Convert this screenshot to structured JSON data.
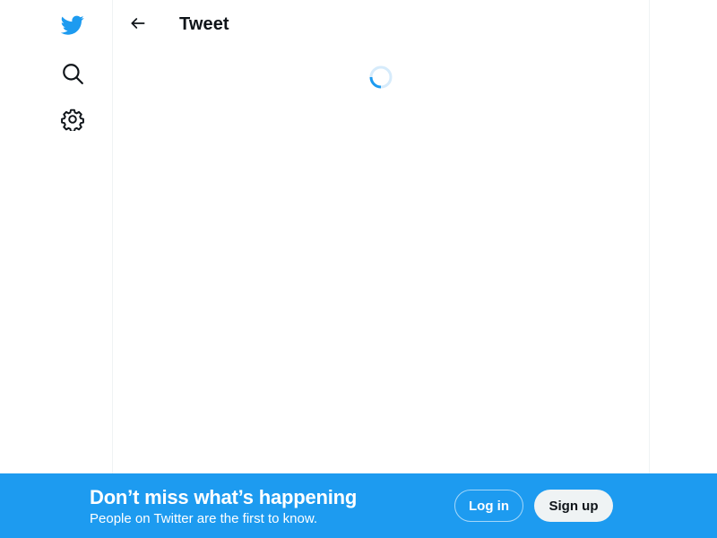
{
  "sidebar": {
    "logo_icon": "twitter-bird-icon",
    "search_icon": "search-icon",
    "settings_icon": "gear-icon"
  },
  "header": {
    "back_icon": "arrow-left-icon",
    "title": "Tweet"
  },
  "content": {
    "loading_indicator": "spinner-icon"
  },
  "banner": {
    "heading": "Don’t miss what’s happening",
    "subtext": "People on Twitter are the first to know.",
    "login_label": "Log in",
    "signup_label": "Sign up"
  },
  "colors": {
    "brand_blue": "#1d9bf0",
    "text_primary": "#0f1419",
    "divider": "#eff3f4"
  }
}
